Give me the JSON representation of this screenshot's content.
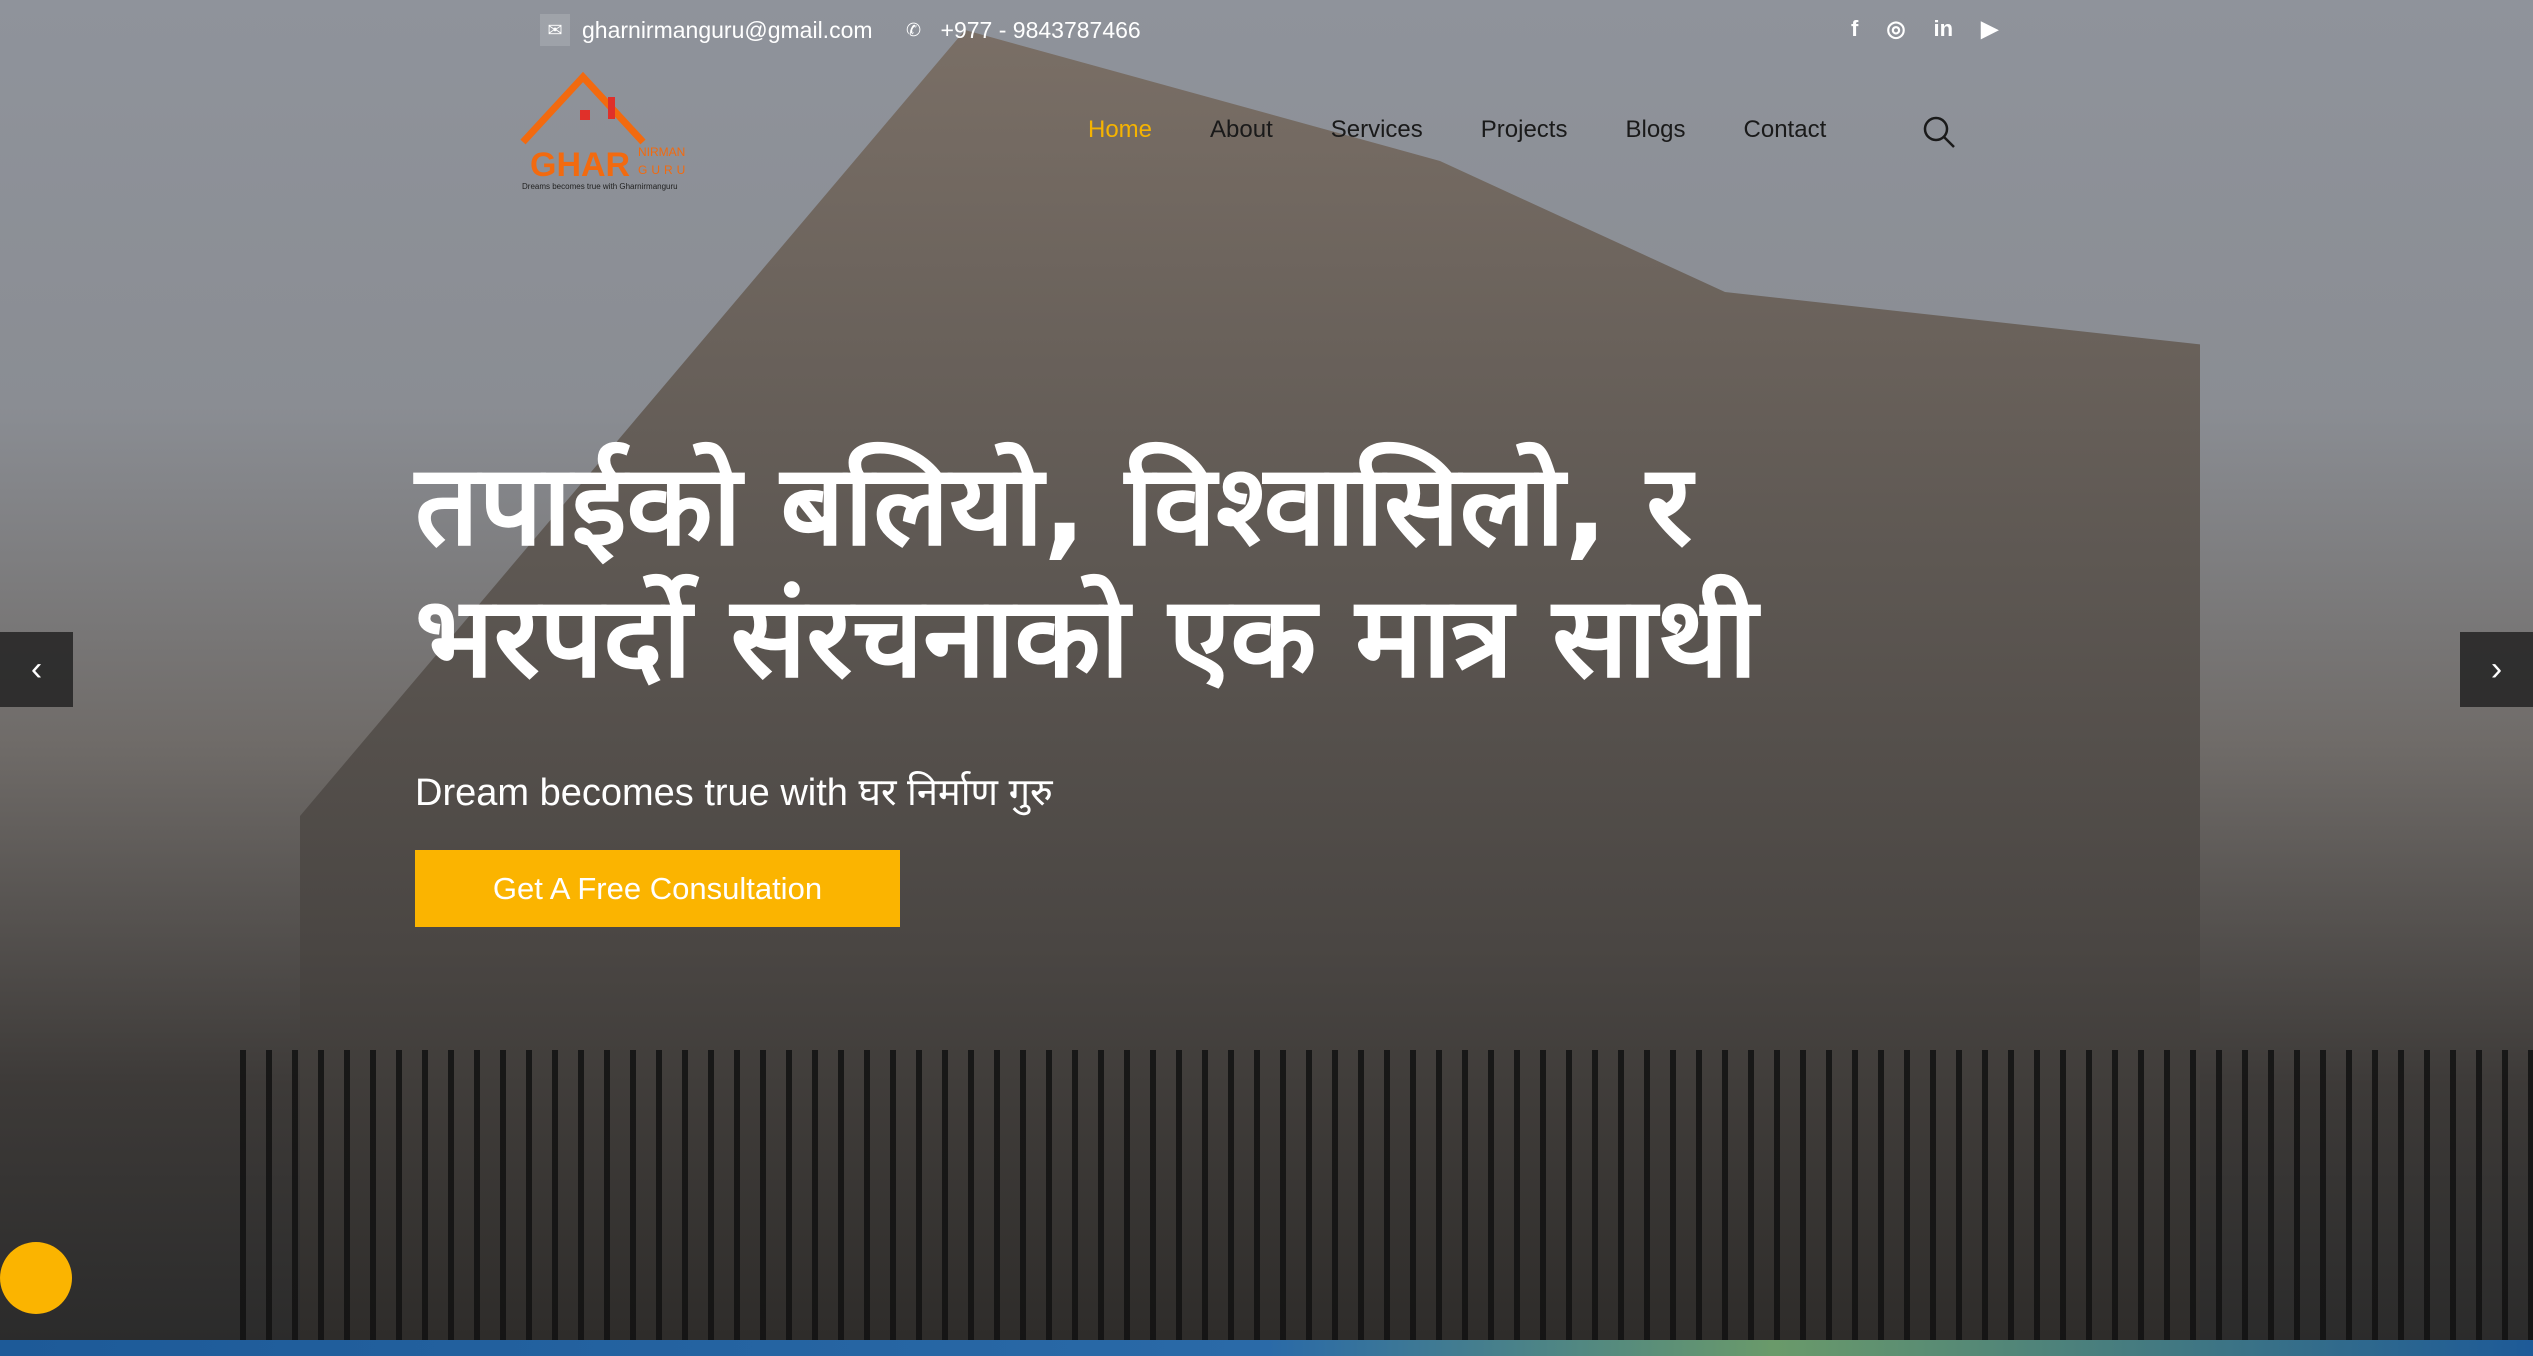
{
  "topbar": {
    "email": "gharnirmanguru@gmail.com",
    "phone": "+977 - 9843787466",
    "email_icon": "envelope-icon",
    "phone_icon": "phone-icon",
    "social": [
      {
        "name": "facebook-icon",
        "glyph": "f"
      },
      {
        "name": "instagram-icon",
        "glyph": "◎"
      },
      {
        "name": "linkedin-icon",
        "glyph": "in"
      },
      {
        "name": "youtube-icon",
        "glyph": "▶"
      }
    ]
  },
  "logo": {
    "word": "GHAR",
    "line1": "NIRMAN",
    "line2": "GURU",
    "tagline": "Dreams becomes true with Gharnirmanguru"
  },
  "nav": {
    "items": [
      "Home",
      "About",
      "Services",
      "Projects",
      "Blogs",
      "Contact"
    ],
    "active": "Home"
  },
  "hero": {
    "title_line1": "तपाईको बलियो, विश्वासिलो, र",
    "title_line2": "भरपर्दो संरचनाको एक मात्र साथी",
    "subtitle": "Dream becomes true with घर निर्माण गुरु",
    "cta": "Get A Free Consultation",
    "prev": "‹",
    "next": "›"
  },
  "colors": {
    "accent": "#fbb400",
    "logo": "#f26a0f"
  }
}
